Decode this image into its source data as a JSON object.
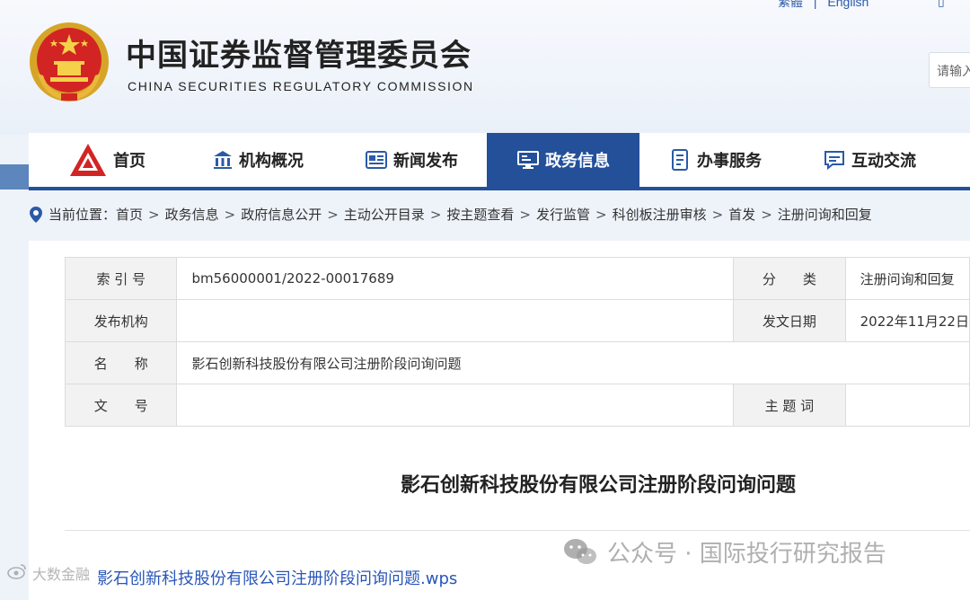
{
  "header": {
    "title": "中国证券监督管理委员会",
    "subtitle": "CHINA SECURITIES REGULATORY COMMISSION",
    "lang_links": [
      "繁體",
      "|",
      "English"
    ],
    "search_placeholder": "请输入",
    "emblem_icon": "national-emblem-icon"
  },
  "nav": {
    "items": [
      {
        "label": "首页",
        "icon": "csrc-logo-icon"
      },
      {
        "label": "机构概况",
        "icon": "building-icon"
      },
      {
        "label": "新闻发布",
        "icon": "newspaper-icon"
      },
      {
        "label": "政务信息",
        "icon": "monitor-icon",
        "active": true
      },
      {
        "label": "办事服务",
        "icon": "document-list-icon"
      },
      {
        "label": "互动交流",
        "icon": "chat-icon"
      }
    ],
    "active_color": "#24509a"
  },
  "breadcrumb": {
    "prefix": "当前位置：",
    "items": [
      "首页",
      "政务信息",
      "政府信息公开",
      "主动公开目录",
      "按主题查看",
      "发行监管",
      "科创板注册审核",
      "首发",
      "注册问询和回复"
    ],
    "separator": ">"
  },
  "meta_table": {
    "index_label": "索 引 号",
    "index_value": "bm56000001/2022-00017689",
    "category_label": "分　　类",
    "category_value": "注册问询和回复",
    "publisher_label": "发布机构",
    "publisher_value": "",
    "date_label": "发文日期",
    "date_value": "2022年11月22日",
    "name_label": "名　　称",
    "name_value": "影石创新科技股份有限公司注册阶段问询问题",
    "docno_label": "文　　号",
    "docno_value": "",
    "keywords_label": "主 题 词",
    "keywords_value": ""
  },
  "document": {
    "title": "影石创新科技股份有限公司注册阶段问询问题",
    "attachment": "影石创新科技股份有限公司注册阶段问询问题.wps"
  },
  "watermarks": {
    "left": "大数金融",
    "right": "公众号 · 国际投行研究报告"
  }
}
